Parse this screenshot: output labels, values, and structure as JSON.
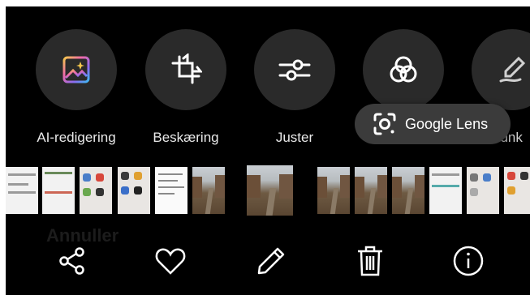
{
  "tools": [
    {
      "label": "AI-redigering",
      "icon": "ai-edit-icon"
    },
    {
      "label": "Beskæring",
      "icon": "crop-icon"
    },
    {
      "label": "Juster",
      "icon": "adjust-sliders-icon"
    },
    {
      "label": "",
      "icon": "filters-icon"
    },
    {
      "label": "",
      "icon": "markup-pen-icon"
    }
  ],
  "clipped_label": "tfunk",
  "lens": {
    "label": "Google Lens",
    "icon": "google-lens-icon"
  },
  "filmstrip": {
    "thumb_kinds": [
      "screen",
      "screen",
      "apps",
      "apps",
      "doc",
      "photo",
      "photo",
      "photo",
      "photo",
      "photo",
      "screen",
      "apps",
      "apps"
    ]
  },
  "ghost_text": "Annuller",
  "actions": [
    {
      "name": "share",
      "icon": "share-icon"
    },
    {
      "name": "favorite",
      "icon": "heart-icon"
    },
    {
      "name": "edit",
      "icon": "pencil-icon"
    },
    {
      "name": "delete",
      "icon": "trash-icon"
    },
    {
      "name": "info",
      "icon": "info-icon"
    }
  ],
  "colors": {
    "background": "#000000",
    "tool_circle": "#2a2a2a",
    "pill": "#3b3b3b",
    "text": "#e9e9e9"
  }
}
